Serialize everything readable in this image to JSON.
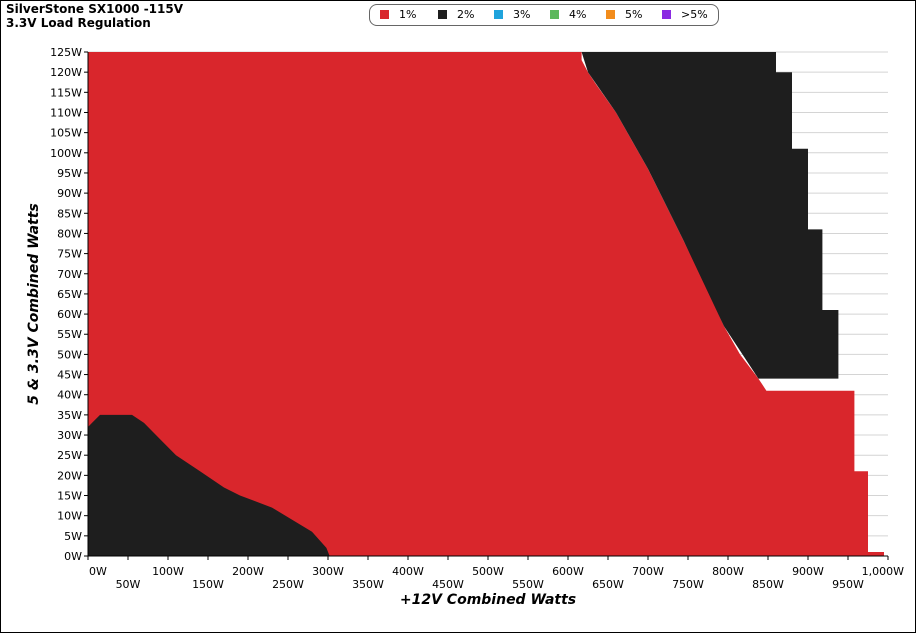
{
  "title": "SilverStone SX1000 -115V",
  "subtitle": "3.3V Load Regulation",
  "legend": [
    {
      "label": "1%",
      "color": "#d9262c"
    },
    {
      "label": "2%",
      "color": "#1e1e1e"
    },
    {
      "label": "3%",
      "color": "#1fa3dc"
    },
    {
      "label": "4%",
      "color": "#5cb85c"
    },
    {
      "label": "5%",
      "color": "#f28c1c"
    },
    {
      "label": ">5%",
      "color": "#8b2be2"
    }
  ],
  "chart_data": {
    "type": "heatmap",
    "title": "3.3V Load Regulation",
    "xlabel": "+12V Combined Watts",
    "ylabel": "5 & 3.3V Combined Watts",
    "x_ticks": [
      "0W",
      "50W",
      "100W",
      "150W",
      "200W",
      "250W",
      "300W",
      "350W",
      "400W",
      "450W",
      "500W",
      "550W",
      "600W",
      "650W",
      "700W",
      "750W",
      "800W",
      "850W",
      "900W",
      "950W",
      "1,000W"
    ],
    "y_ticks": [
      "0W",
      "5W",
      "10W",
      "15W",
      "20W",
      "25W",
      "30W",
      "35W",
      "40W",
      "45W",
      "50W",
      "55W",
      "60W",
      "65W",
      "70W",
      "75W",
      "80W",
      "85W",
      "90W",
      "95W",
      "100W",
      "105W",
      "110W",
      "115W",
      "120W",
      "125W"
    ],
    "xlim": [
      0,
      1000
    ],
    "ylim": [
      0,
      125
    ],
    "grid": true,
    "regions": [
      {
        "name": "1%",
        "description": "deviation within 1% across most of the load range",
        "upper_boundary": [
          [
            0,
            125
          ],
          [
            617,
            125
          ],
          [
            617,
            123
          ],
          [
            625,
            120
          ],
          [
            635,
            117
          ],
          [
            660,
            110
          ],
          [
            680,
            103
          ],
          [
            700,
            96
          ],
          [
            720,
            88
          ],
          [
            745,
            78
          ],
          [
            770,
            68
          ],
          [
            795,
            57
          ],
          [
            815,
            50
          ],
          [
            838,
            44
          ],
          [
            848,
            41
          ],
          [
            958,
            41
          ],
          [
            958,
            21
          ],
          [
            975,
            21
          ],
          [
            975,
            1
          ],
          [
            995,
            1
          ],
          [
            995,
            0
          ]
        ]
      },
      {
        "name": "2%",
        "description": "deviation within 2% at high +12V / high minor-rail load",
        "lower_boundary": [
          [
            617,
            125
          ],
          [
            625,
            120
          ],
          [
            660,
            110
          ],
          [
            700,
            96
          ],
          [
            745,
            78
          ],
          [
            795,
            57
          ],
          [
            838,
            44
          ]
        ],
        "outer_boundary": [
          [
            860,
            125
          ],
          [
            860,
            120
          ],
          [
            880,
            120
          ],
          [
            880,
            101
          ],
          [
            900,
            101
          ],
          [
            900,
            81
          ],
          [
            918,
            81
          ],
          [
            918,
            61
          ],
          [
            938,
            61
          ],
          [
            938,
            44
          ]
        ]
      },
      {
        "name": "2%",
        "description": "deviation within 2% at low +12V load",
        "upper_boundary": [
          [
            0,
            32
          ],
          [
            5,
            33
          ],
          [
            15,
            35
          ],
          [
            55,
            35
          ],
          [
            70,
            33
          ],
          [
            90,
            29
          ],
          [
            110,
            25
          ],
          [
            140,
            21
          ],
          [
            170,
            17
          ],
          [
            190,
            15
          ],
          [
            230,
            12
          ],
          [
            280,
            6
          ],
          [
            298,
            2
          ],
          [
            302,
            0
          ]
        ]
      }
    ]
  }
}
